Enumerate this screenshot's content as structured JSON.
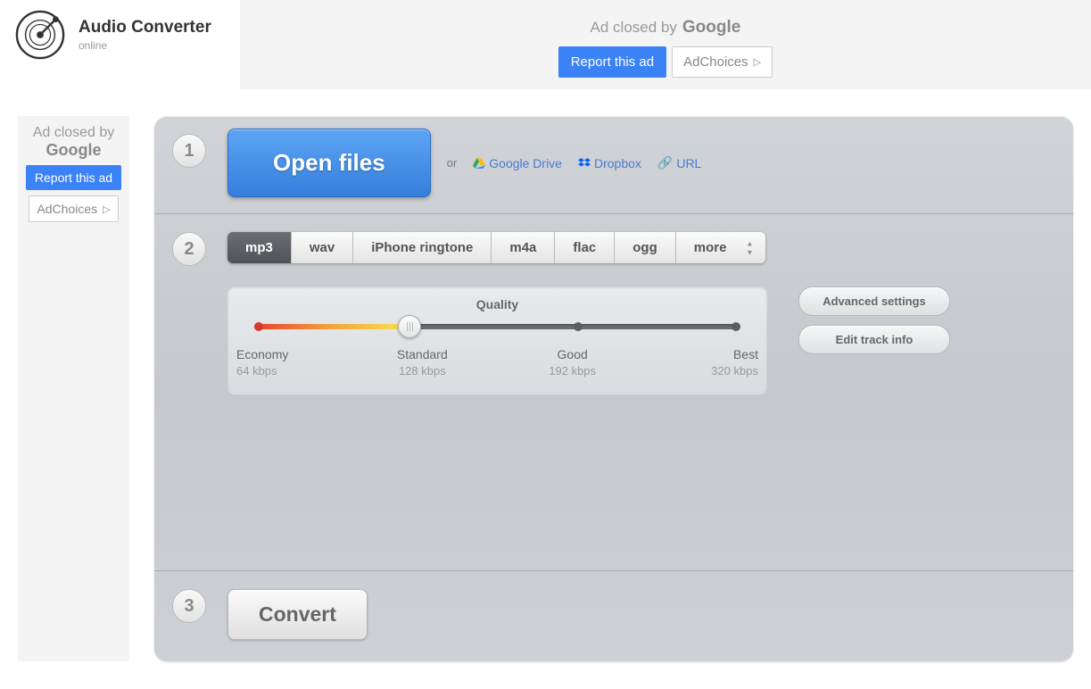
{
  "brand": {
    "title": "Audio Converter",
    "subtitle": "online"
  },
  "top_ad": {
    "closed_text": "Ad closed by",
    "google": "Google",
    "report": "Report this ad",
    "adchoices": "AdChoices"
  },
  "side_ad": {
    "closed_text": "Ad closed by",
    "google": "Google",
    "report": "Report this ad",
    "adchoices": "AdChoices"
  },
  "step1": {
    "num": "1",
    "open": "Open files",
    "or": "or",
    "gdrive": "Google Drive",
    "dropbox": "Dropbox",
    "url": "URL"
  },
  "step2": {
    "num": "2",
    "formats": [
      "mp3",
      "wav",
      "iPhone ringtone",
      "m4a",
      "flac",
      "ogg",
      "more"
    ],
    "active_format": "mp3",
    "quality_label": "Quality",
    "levels": [
      {
        "name": "Economy",
        "rate": "64 kbps"
      },
      {
        "name": "Standard",
        "rate": "128 kbps"
      },
      {
        "name": "Good",
        "rate": "192 kbps"
      },
      {
        "name": "Best",
        "rate": "320 kbps"
      }
    ],
    "advanced": "Advanced settings",
    "edit_track": "Edit track info"
  },
  "step3": {
    "num": "3",
    "convert": "Convert"
  }
}
